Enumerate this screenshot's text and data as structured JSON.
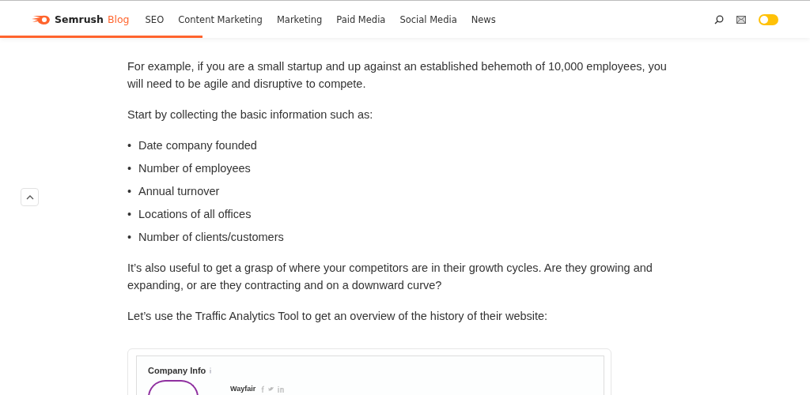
{
  "header": {
    "logo": "Semrush",
    "logo_suffix": "Blog",
    "nav": [
      "SEO",
      "Content Marketing",
      "Marketing",
      "Paid Media",
      "Social Media",
      "News"
    ],
    "dark_mode_toggle": {
      "on": false
    },
    "reading_progress": {
      "level": 0.25
    }
  },
  "article": {
    "bullet": "•",
    "paragraphs_before": [
      "For example, if you are a small startup and up against an established behemoth of 10,000 employees, you will need to be agile and disruptive to compete.",
      "Start by collecting the basic information such as:"
    ],
    "list": [
      "Date company founded",
      "Number of employees",
      "Annual turnover",
      "Locations of all offices",
      "Number of clients/customers"
    ],
    "paragraphs_after": [
      "It’s also useful to get a grasp of where your competitors are in their growth cycles. Are they growing and expanding, or are they contracting and on a downward curve?",
      "Let’s use the Traffic Analytics Tool to get an overview of the history of their website:"
    ],
    "embedded_screenshot": {
      "title": "Company Info",
      "company": "Wayfair"
    }
  }
}
